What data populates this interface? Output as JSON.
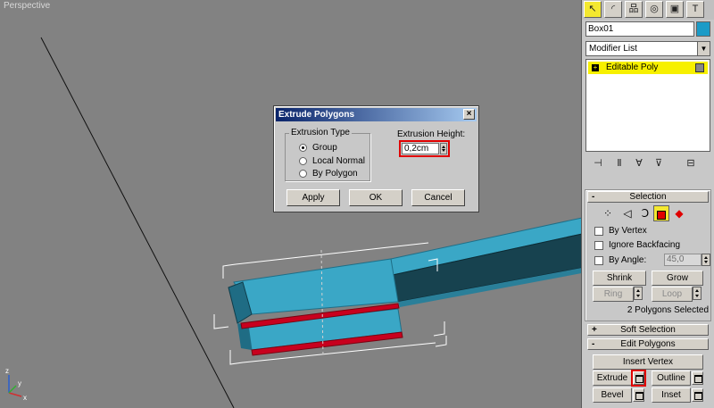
{
  "viewport": {
    "label": "Perspective",
    "background": "#828282",
    "object_color": "#3aa7c6",
    "selected_face_color": "#c8001e",
    "axis": {
      "x": "x",
      "y": "y",
      "z": "z"
    }
  },
  "dialog": {
    "title": "Extrude Polygons",
    "close_glyph": "×",
    "extrusion_type": {
      "legend": "Extrusion Type",
      "options": [
        {
          "label": "Group",
          "checked": true
        },
        {
          "label": "Local Normal",
          "checked": false
        },
        {
          "label": "By Polygon",
          "checked": false
        }
      ]
    },
    "extrusion_height": {
      "label": "Extrusion Height:",
      "value": "0,2cm"
    },
    "buttons": {
      "apply": "Apply",
      "ok": "OK",
      "cancel": "Cancel"
    }
  },
  "panel": {
    "tabs": [
      {
        "icon": "cursor-icon",
        "glyph": "↖",
        "active": true
      },
      {
        "icon": "modify-icon",
        "glyph": "◜",
        "active": false
      },
      {
        "icon": "hierarchy-icon",
        "glyph": "品",
        "active": false
      },
      {
        "icon": "motion-icon",
        "glyph": "◎",
        "active": false
      },
      {
        "icon": "display-icon",
        "glyph": "▣",
        "active": false
      },
      {
        "icon": "utilities-icon",
        "glyph": "T",
        "active": false
      }
    ],
    "object_name": "Box01",
    "object_color": "#1b9bc7",
    "modifier_list": "Modifier List",
    "stack_item": "Editable Poly",
    "stack_item_color": "#f7f000",
    "selection": {
      "title": "Selection",
      "by_vertex": "By Vertex",
      "ignore_backfacing": "Ignore Backfacing",
      "by_angle": "By Angle:",
      "angle_value": "45,0",
      "shrink": "Shrink",
      "grow": "Grow",
      "ring": "Ring",
      "loop": "Loop",
      "status": "2 Polygons Selected"
    },
    "soft_selection": {
      "title": "Soft Selection",
      "sign": "+"
    },
    "edit_polygons": {
      "title": "Edit Polygons",
      "sign": "-",
      "insert_vertex": "Insert Vertex",
      "extrude": "Extrude",
      "outline": "Outline",
      "bevel": "Bevel",
      "inset": "Inset"
    },
    "rollout_minus": "-"
  }
}
